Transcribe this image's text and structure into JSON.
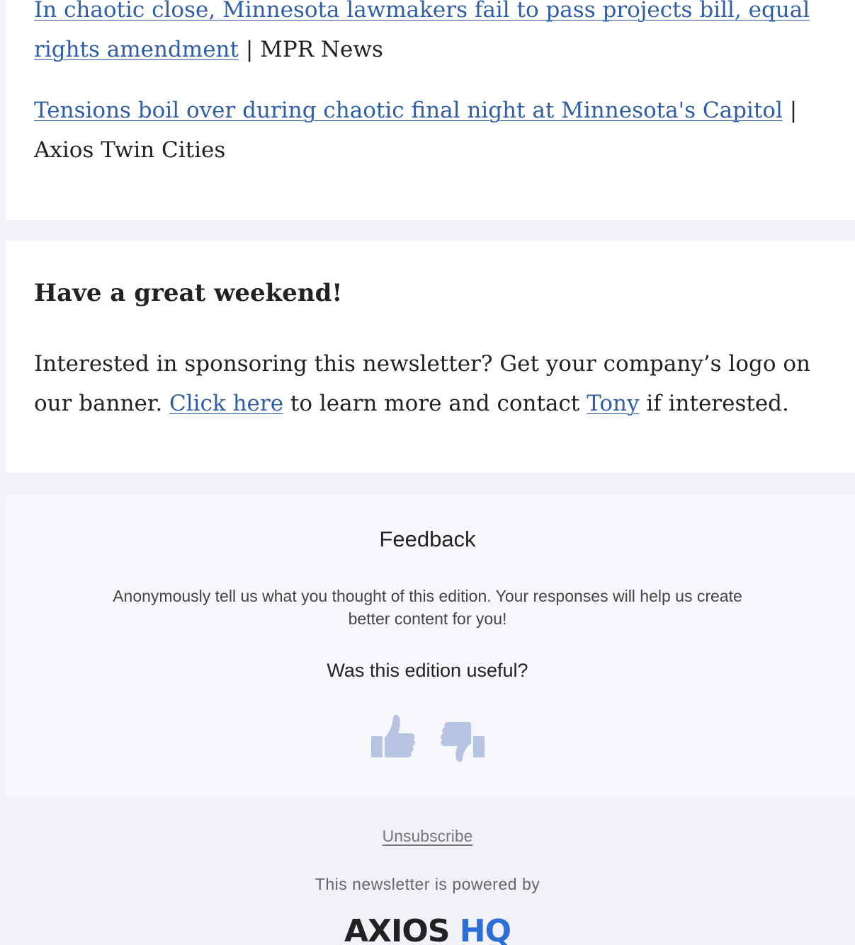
{
  "stories": [
    {
      "link_text": "In chaotic close, Minnesota lawmakers fail to pass projects bill, equal rights amendment",
      "source": "MPR News"
    },
    {
      "link_text": "Tensions boil over during chaotic final night at Minnesota's Capitol",
      "source": "Axios Twin Cities"
    }
  ],
  "separator": "|",
  "weekend": {
    "title": "Have a great weekend!",
    "body_part1": "Interested in sponsoring this newsletter? Get your company’s logo on our banner. ",
    "link1": "Click here",
    "body_part2": " to learn more and contact ",
    "link2": "Tony",
    "body_part3": " if interested."
  },
  "feedback": {
    "title": "Feedback",
    "description": "Anonymously tell us what you thought of this edition. Your responses will help us create better content for you!",
    "question": "Was this edition useful?",
    "thumb_color": "#b7c3e2",
    "icons": [
      "thumbs-up-icon",
      "thumbs-down-icon"
    ]
  },
  "footer": {
    "unsubscribe": "Unsubscribe",
    "powered_by": "This newsletter is powered by",
    "logo_part1": "AXIOS",
    "logo_part2": "HQ"
  }
}
